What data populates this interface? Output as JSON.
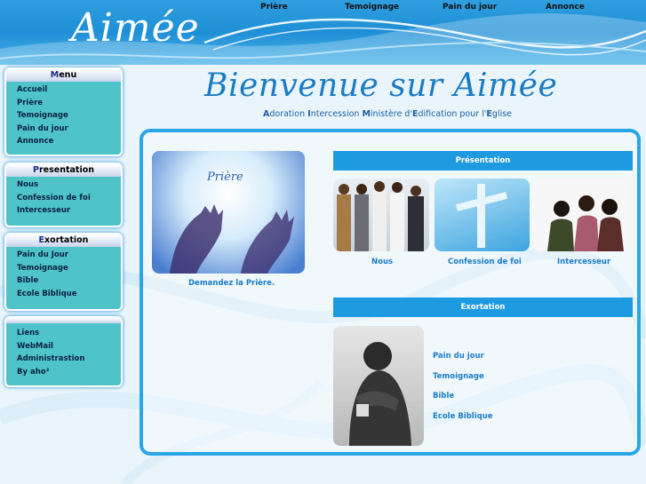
{
  "header": {
    "logo": "Aimée",
    "nav": [
      "Prière",
      "Temoignage",
      "Pain du jour",
      "Annonce"
    ]
  },
  "sidebar": {
    "menu": {
      "title_first": "M",
      "title_rest": "enu",
      "items": [
        "Accueil",
        "Prière",
        "Temoignage",
        "Pain du jour",
        "Annonce"
      ]
    },
    "presentation": {
      "title_first": "P",
      "title_rest": "resentation",
      "items": [
        "Nous",
        "Confession de foi",
        "Intercesseur"
      ]
    },
    "exortation": {
      "title_first": "E",
      "title_rest": "xortation",
      "items": [
        "Pain du Jour",
        "Temoignage",
        "Bible",
        "Ecole Biblique"
      ]
    },
    "links": {
      "items": [
        "Liens",
        "WebMail",
        "Administrastion",
        "By aho²"
      ]
    }
  },
  "main": {
    "title": "Bienvenue sur Aimée",
    "subtitle_parts": [
      {
        "cap": "A",
        "rest": "doration "
      },
      {
        "cap": "I",
        "rest": "ntercession "
      },
      {
        "cap": "M",
        "rest": "inistère d'"
      },
      {
        "cap": "E",
        "rest": "dification pour l'"
      },
      {
        "cap": "E",
        "rest": "glise"
      }
    ],
    "priere_image_text": "Prière",
    "priere_caption": "Demandez la Prière.",
    "presentation_bar": "Présentation",
    "presentation_items": [
      "Nous",
      "Confession de foi",
      "Intercesseur"
    ],
    "exortation_bar": "Exortation",
    "exortation_links": [
      "Pain du jour",
      "Temoignage",
      "Bible",
      "Ecole Biblique"
    ]
  },
  "colors": {
    "accent": "#1e9ae0",
    "sidebar": "#4ec4c9",
    "link": "#1a7cc8",
    "title": "#1b7cc4"
  }
}
